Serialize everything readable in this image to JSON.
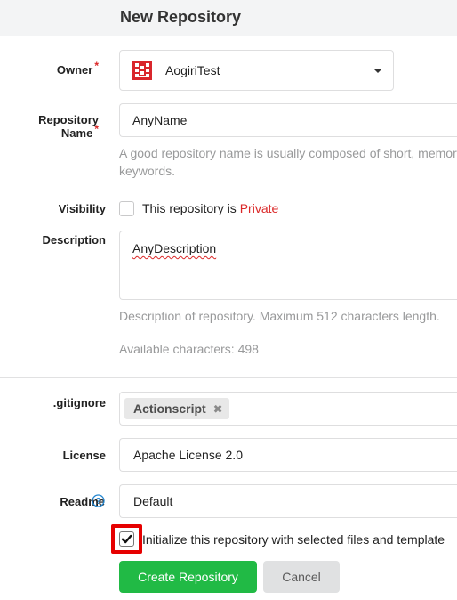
{
  "header": {
    "title": "New Repository"
  },
  "owner": {
    "label": "Owner",
    "required_mark": "*",
    "value": "AogiriTest",
    "icon": "chevron-down-icon",
    "avatar_color": "#d9262c"
  },
  "repo_name": {
    "label": "Repository Name",
    "required_mark": "*",
    "value": "AnyName",
    "help": "A good repository name is usually composed of short, memor",
    "help2": "keywords."
  },
  "visibility": {
    "label": "Visibility",
    "text": "This repository is ",
    "private_text": "Private",
    "private_color": "#db2828"
  },
  "description": {
    "label": "Description",
    "value": "AnyDescription",
    "help": "Description of repository. Maximum 512 characters length.",
    "available": "Available characters: 498"
  },
  "gitignore": {
    "label": ".gitignore",
    "tag": "Actionscript",
    "remove_icon": "close-icon"
  },
  "license": {
    "label": "License",
    "value": "Apache License 2.0"
  },
  "readme": {
    "label": "Readme",
    "help_icon": "question-circle-icon",
    "value": "Default"
  },
  "auto_init": {
    "checked": true,
    "text": "Initialize this repository with selected files and template",
    "highlight_color": "#e60000"
  },
  "actions": {
    "create": "Create Repository",
    "cancel": "Cancel",
    "create_color": "#21ba45",
    "cancel_color": "#e0e1e2"
  }
}
